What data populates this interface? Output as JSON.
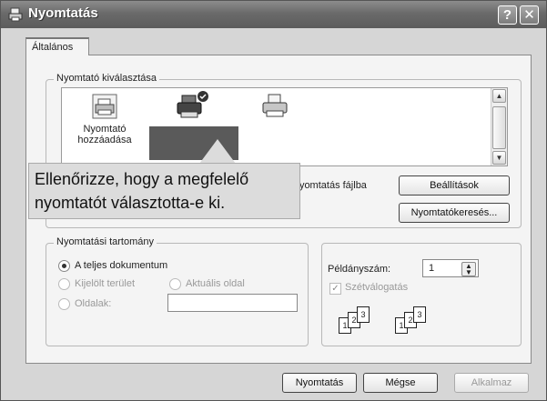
{
  "window": {
    "title": "Nyomtatás",
    "help_button": "?",
    "close_button": "✕"
  },
  "tab": {
    "label": "Általános"
  },
  "printer_group": {
    "legend": "Nyomtató kiválasztása",
    "add_printer_label_line1": "Nyomtató",
    "add_printer_label_line2": "hozzáadása",
    "print_to_file_label": "Nyomtatás fájlba",
    "settings_button": "Beállítások",
    "find_printer_button": "Nyomtatókeresés..."
  },
  "callout": {
    "line1": "Ellenőrizze, hogy a megfelelő",
    "line2": "nyomtatót választotta-e ki."
  },
  "range_group": {
    "legend": "Nyomtatási tartomány",
    "all": "A teljes dokumentum",
    "selection": "Kijelölt terület",
    "current_page": "Aktuális oldal",
    "pages": "Oldalak:"
  },
  "copies_group": {
    "copies_label": "Példányszám:",
    "copies_value": "1",
    "collate_label": "Szétválogatás",
    "collate_checked": true,
    "collate_pages": [
      "1",
      "2",
      "3"
    ]
  },
  "buttons": {
    "print": "Nyomtatás",
    "cancel": "Mégse",
    "apply": "Alkalmaz"
  }
}
